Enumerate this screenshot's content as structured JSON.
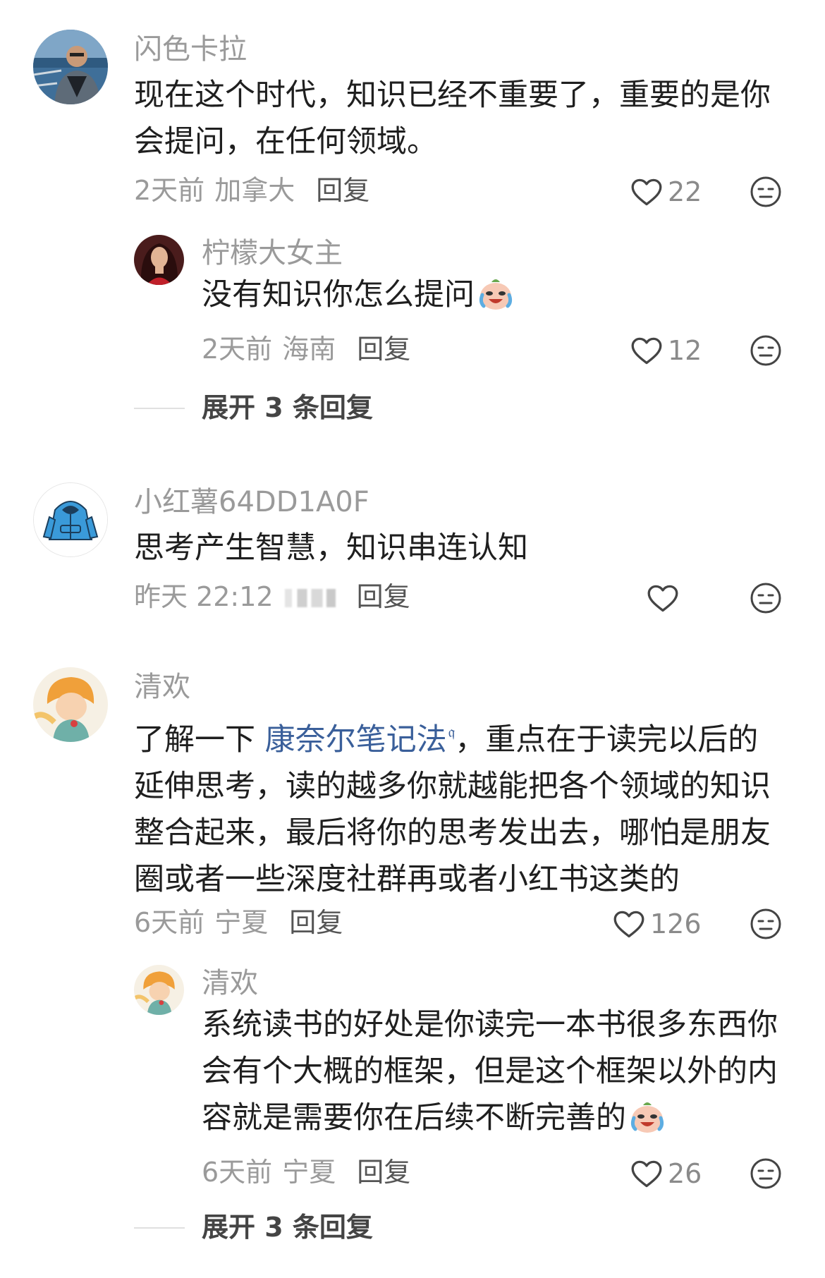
{
  "colors": {
    "name": "#9a9a9a",
    "text": "#1f1f1f",
    "link": "#3a5f9a",
    "meta": "#9a9a9a",
    "reply": "#555555"
  },
  "comments": [
    {
      "name": "闪色卡拉",
      "avatar_icon": "user-photo-avatar",
      "lines": [
        "现在这个时代，知识已经不重要了，重要的是你",
        "会提问，在任何领域。"
      ],
      "time": "2天前",
      "location": "加拿大",
      "reply_label": "回复",
      "likes": "22",
      "replies": [
        {
          "name": "柠檬大女主",
          "avatar_icon": "user-photo-avatar",
          "lines": [
            "没有知识你怎么提问"
          ],
          "emoji": "crying-laugh-emoji",
          "time": "2天前",
          "location": "海南",
          "reply_label": "回复",
          "likes": "12"
        }
      ],
      "expand_label": "展开 3 条回复"
    },
    {
      "name": "小红薯64DD1A0F",
      "avatar_icon": "hoodie-avatar-icon",
      "lines": [
        "思考产生智慧，知识串连认知"
      ],
      "time": "昨天 22:12",
      "location": "",
      "reply_label": "回复",
      "likes": ""
    },
    {
      "name": "清欢",
      "avatar_icon": "little-prince-avatar",
      "line1_before": "了解一下 ",
      "line1_link": "康奈尔笔记法",
      "line1_after": "，重点在于读完以后的",
      "lines": [
        "延伸思考，读的越多你就越能把各个领域的知识",
        "整合起来，最后将你的思考发出去，哪怕是朋友",
        "圈或者一些深度社群再或者小红书这类的"
      ],
      "time": "6天前",
      "location": "宁夏",
      "reply_label": "回复",
      "likes": "126",
      "replies": [
        {
          "name": "清欢",
          "avatar_icon": "little-prince-avatar",
          "lines": [
            "系统读书的好处是你读完一本书很多东西你",
            "会有个大概的框架，但是这个框架以外的内",
            "容就是需要你在后续不断完善的"
          ],
          "emoji": "crying-laugh-emoji",
          "time": "6天前",
          "location": "宁夏",
          "reply_label": "回复",
          "likes": "26"
        }
      ],
      "expand_label": "展开 3 条回复"
    }
  ]
}
